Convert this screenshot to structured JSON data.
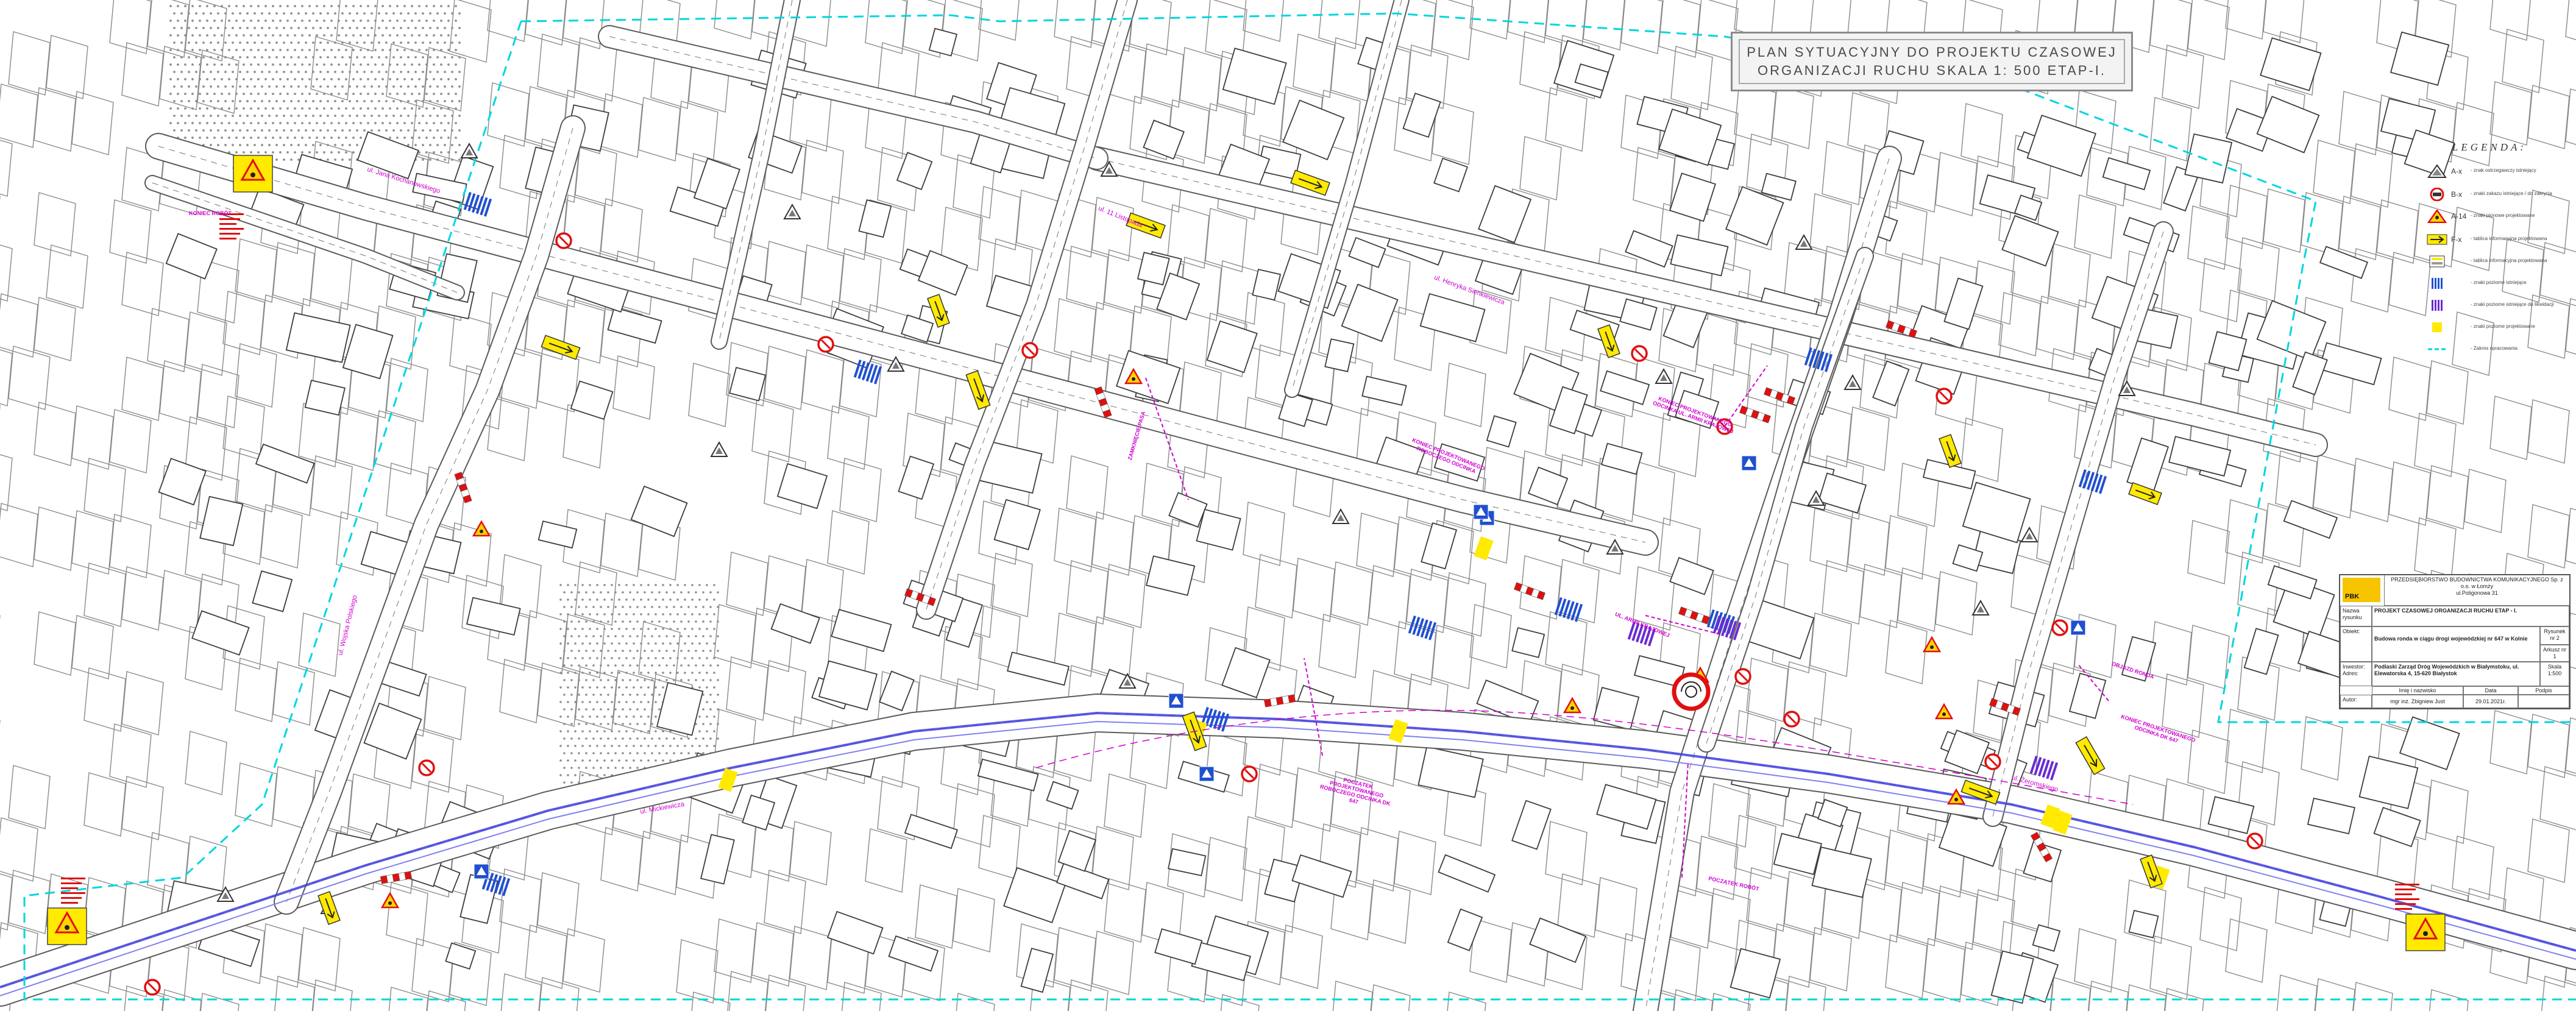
{
  "title": {
    "line1": "PLAN SYTUACYJNY DO PROJEKTU CZASOWEJ",
    "line2": "ORGANIZACJI RUCHU SKALA 1: 500 ETAP-I."
  },
  "legend": {
    "heading": "LEGENDA:",
    "items": [
      {
        "code": "A-x",
        "icon": "warning-sign-icon",
        "desc": "- znak ostrzegawczy istniejący"
      },
      {
        "code": "B-x",
        "icon": "prohibition-sign-icon",
        "desc": "- znaki zakazu istniejące / do zakrycia"
      },
      {
        "code": "A-14",
        "icon": "roadworks-sign-icon",
        "desc": "- znaki pionowe projektowane"
      },
      {
        "code": "F-x",
        "icon": "detour-board-icon",
        "desc": "- tablica informacyjna projektowana"
      },
      {
        "code": "",
        "icon": "small-board-icon",
        "desc": "- tablica informacyjna projektowana"
      },
      {
        "code": "",
        "icon": "crossing-blue-icon",
        "desc": "- znaki poziome istniejące"
      },
      {
        "code": "",
        "icon": "crossing-violet-icon",
        "desc": "- znaki poziome istniejące do likwidacji"
      },
      {
        "code": "",
        "icon": "yellow-marking-icon",
        "desc": "- znaki poziome projektowane"
      },
      {
        "code": "",
        "icon": "boundary-line-icon",
        "desc": "- Zakres opracowania"
      }
    ]
  },
  "stamp": {
    "company_name": "PRZEDSIĘBIORSTWO BUDOWNICTWA KOMUNIKACYJNEGO Sp. z o.o. w Łomży",
    "company_address": "ul.Poligonowa 31",
    "logo_text": "PBK",
    "role_label": "Nazwa rysunku",
    "drawing_title": "PROJEKT CZASOWEJ ORGANIZACJI RUCHU ETAP - I.",
    "object_label": "Obiekt:",
    "object_value": "Budowa ronda w ciągu drogi wojewódzkiej nr 647 w Kolnie",
    "sheet_label": "Rysunek nr 2",
    "arkusz_label": "Arkusz nr 1",
    "investor_label": "Inwestor: Adres:",
    "investor_value": "Podlaski Zarząd Dróg Wojewódzkich w Białymstoku, ul. Elewatorska 4, 15-620 Białystok",
    "scale_label": "Skala 1:500",
    "author_role": "Autor:",
    "name_header": "Imię i nazwisko",
    "date_header": "Data",
    "sign_header": "Podpis",
    "author_name": "mgr inż. Zbigniew Just",
    "date_value": "29.01.2021r."
  },
  "labels": {
    "street_1": "ul. Jana Kochanowskiego",
    "street_2": "ul. 11 Listopada",
    "street_3": "ul. Wojska Polskiego",
    "street_4": "ul. Henryka Sienkiewicza",
    "street_5": "ul. Mickiewicza",
    "street_6": "ul. Żeromskiego",
    "magenta_1": "KONIEC PROJEKTOWANEGO ROBOCZEGO ODCINKA",
    "magenta_2": "POCZĄTEK PROJEKTOWANEGO ROBOCZEGO ODCINKA DK 647",
    "magenta_3": "KONIEC PROJEKTOWANEGO ODCINKA UL. ARMII KRAJOWEJ",
    "magenta_4": "UL. ARMII KRAJOWEJ",
    "magenta_5": "KONIEC PROJEKTOWANEGO ODCINKA DK 647",
    "magenta_6": "OBJAZD RONDA",
    "magenta_7": "POCZĄTEK ROBÓT",
    "magenta_8": "ZAMKNIĘCIE PASA",
    "magenta_9": "KONIEC ROBÓT"
  },
  "colors": {
    "boundary": "#00d6e0",
    "road_edge": "#5a5a5a",
    "axis": "#3e3ee0",
    "magenta": "#d000d0",
    "sign_yellow": "#ffea00",
    "sign_red": "#e01010",
    "sign_blue": "#2050d0",
    "building": "#3c3c3c",
    "parcel": "#8a8a8a"
  }
}
